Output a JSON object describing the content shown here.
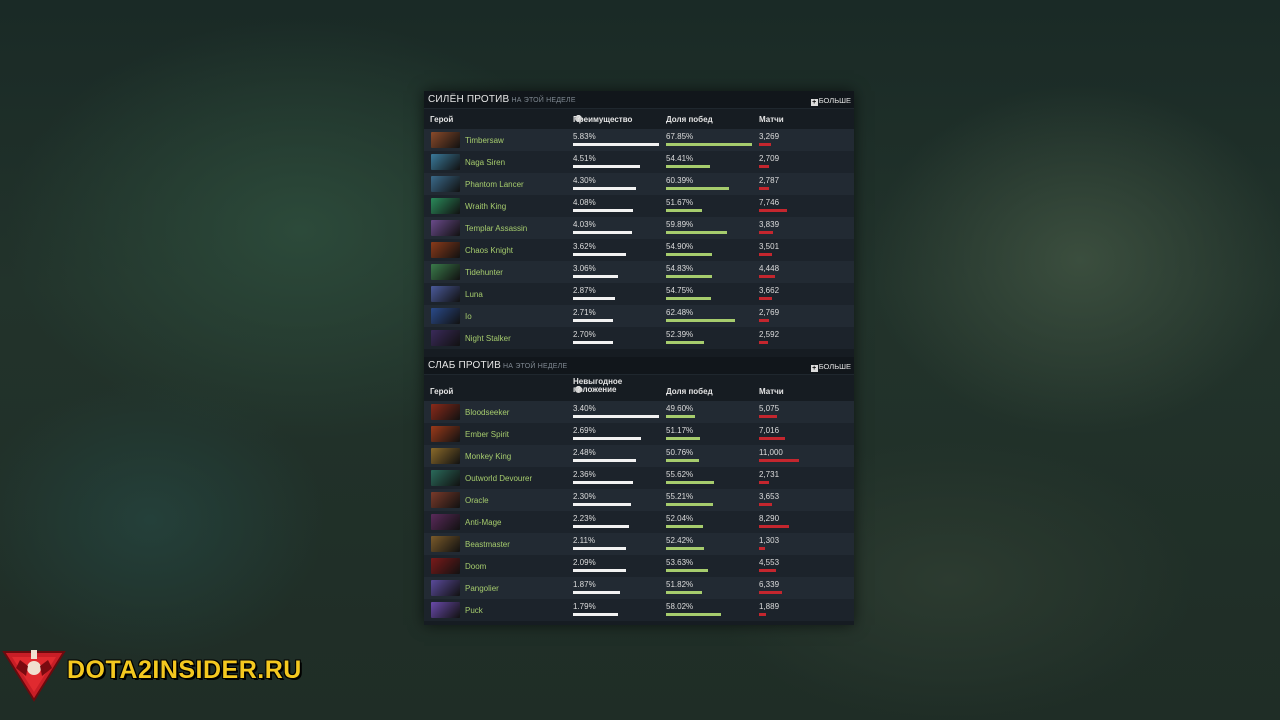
{
  "strong": {
    "title": "СИЛЁН ПРОТИВ",
    "subtitle": "НА ЭТОЙ НЕДЕЛЕ",
    "more_label": "БОЛЬШЕ",
    "columns": {
      "hero": "Герой",
      "metric": "Преимущество",
      "winrate": "Доля побед",
      "matches": "Матчи"
    },
    "rows": [
      {
        "name": "Timbersaw",
        "metric": "5.83%",
        "winrate": "67.85%",
        "matches": "3,269",
        "metric_val": 5.83,
        "win_val": 67.85,
        "match_val": 3269,
        "color": "#8a4a2a"
      },
      {
        "name": "Naga Siren",
        "metric": "4.51%",
        "winrate": "54.41%",
        "matches": "2,709",
        "metric_val": 4.51,
        "win_val": 54.41,
        "match_val": 2709,
        "color": "#3a7a9a"
      },
      {
        "name": "Phantom Lancer",
        "metric": "4.30%",
        "winrate": "60.39%",
        "matches": "2,787",
        "metric_val": 4.3,
        "win_val": 60.39,
        "match_val": 2787,
        "color": "#3a6a8a"
      },
      {
        "name": "Wraith King",
        "metric": "4.08%",
        "winrate": "51.67%",
        "matches": "7,746",
        "metric_val": 4.08,
        "win_val": 51.67,
        "match_val": 7746,
        "color": "#2a8a5a"
      },
      {
        "name": "Templar Assassin",
        "metric": "4.03%",
        "winrate": "59.89%",
        "matches": "3,839",
        "metric_val": 4.03,
        "win_val": 59.89,
        "match_val": 3839,
        "color": "#6a4a8a"
      },
      {
        "name": "Chaos Knight",
        "metric": "3.62%",
        "winrate": "54.90%",
        "matches": "3,501",
        "metric_val": 3.62,
        "win_val": 54.9,
        "match_val": 3501,
        "color": "#8a3a1a"
      },
      {
        "name": "Tidehunter",
        "metric": "3.06%",
        "winrate": "54.83%",
        "matches": "4,448",
        "metric_val": 3.06,
        "win_val": 54.83,
        "match_val": 4448,
        "color": "#3a7a4a"
      },
      {
        "name": "Luna",
        "metric": "2.87%",
        "winrate": "54.75%",
        "matches": "3,662",
        "metric_val": 2.87,
        "win_val": 54.75,
        "match_val": 3662,
        "color": "#4a5a9a"
      },
      {
        "name": "Io",
        "metric": "2.71%",
        "winrate": "62.48%",
        "matches": "2,769",
        "metric_val": 2.71,
        "win_val": 62.48,
        "match_val": 2769,
        "color": "#2a4a8a"
      },
      {
        "name": "Night Stalker",
        "metric": "2.70%",
        "winrate": "52.39%",
        "matches": "2,592",
        "metric_val": 2.7,
        "win_val": 52.39,
        "match_val": 2592,
        "color": "#3a2a5a"
      }
    ]
  },
  "weak": {
    "title": "СЛАБ ПРОТИВ",
    "subtitle": "НА ЭТОЙ НЕДЕЛЕ",
    "more_label": "БОЛЬШЕ",
    "columns": {
      "hero": "Герой",
      "metric_line1": "Невыгодное",
      "metric_line2": "положение",
      "winrate": "Доля побед",
      "matches": "Матчи"
    },
    "rows": [
      {
        "name": "Bloodseeker",
        "metric": "3.40%",
        "winrate": "49.60%",
        "matches": "5,075",
        "metric_val": 3.4,
        "win_val": 49.6,
        "match_val": 5075,
        "color": "#8a2a1a"
      },
      {
        "name": "Ember Spirit",
        "metric": "2.69%",
        "winrate": "51.17%",
        "matches": "7,016",
        "metric_val": 2.69,
        "win_val": 51.17,
        "match_val": 7016,
        "color": "#9a3a1a"
      },
      {
        "name": "Monkey King",
        "metric": "2.48%",
        "winrate": "50.76%",
        "matches": "11,000",
        "metric_val": 2.48,
        "win_val": 50.76,
        "match_val": 11000,
        "color": "#8a6a2a"
      },
      {
        "name": "Outworld Devourer",
        "metric": "2.36%",
        "winrate": "55.62%",
        "matches": "2,731",
        "metric_val": 2.36,
        "win_val": 55.62,
        "match_val": 2731,
        "color": "#2a6a5a"
      },
      {
        "name": "Oracle",
        "metric": "2.30%",
        "winrate": "55.21%",
        "matches": "3,653",
        "metric_val": 2.3,
        "win_val": 55.21,
        "match_val": 3653,
        "color": "#7a3a2a"
      },
      {
        "name": "Anti-Mage",
        "metric": "2.23%",
        "winrate": "52.04%",
        "matches": "8,290",
        "metric_val": 2.23,
        "win_val": 52.04,
        "match_val": 8290,
        "color": "#5a2a5a"
      },
      {
        "name": "Beastmaster",
        "metric": "2.11%",
        "winrate": "52.42%",
        "matches": "1,303",
        "metric_val": 2.11,
        "win_val": 52.42,
        "match_val": 1303,
        "color": "#7a5a2a"
      },
      {
        "name": "Doom",
        "metric": "2.09%",
        "winrate": "53.63%",
        "matches": "4,553",
        "metric_val": 2.09,
        "win_val": 53.63,
        "match_val": 4553,
        "color": "#7a1a1a"
      },
      {
        "name": "Pangolier",
        "metric": "1.87%",
        "winrate": "51.82%",
        "matches": "6,339",
        "metric_val": 1.87,
        "win_val": 51.82,
        "match_val": 6339,
        "color": "#5a4a9a"
      },
      {
        "name": "Puck",
        "metric": "1.79%",
        "winrate": "58.02%",
        "matches": "1,889",
        "metric_val": 1.79,
        "win_val": 58.02,
        "match_val": 1889,
        "color": "#6a4aaa"
      }
    ]
  },
  "brand": {
    "text": "DOTA2INSIDER.RU"
  }
}
